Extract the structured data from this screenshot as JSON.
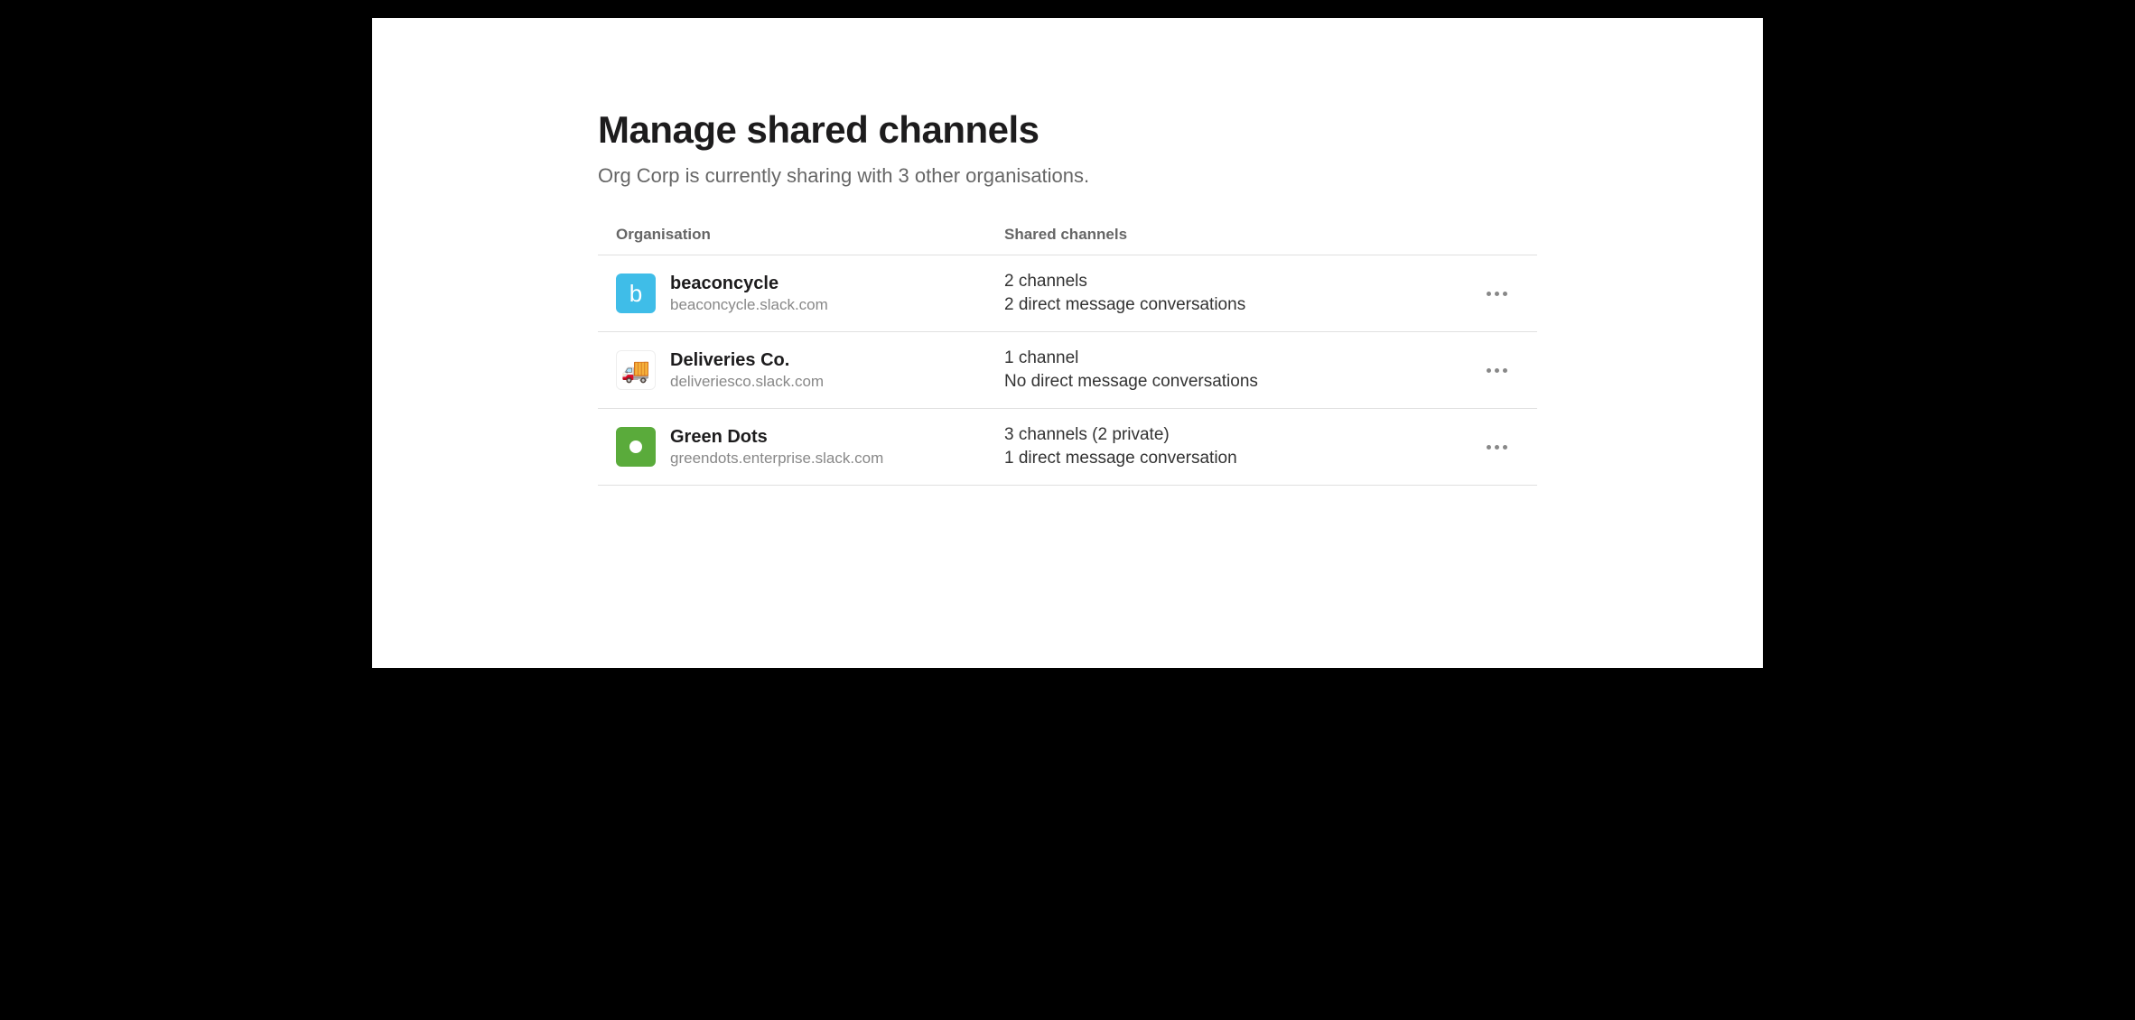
{
  "page": {
    "title": "Manage shared channels",
    "subtitle": "Org Corp is currently sharing with 3 other organisations."
  },
  "table": {
    "headers": {
      "organisation": "Organisation",
      "shared_channels": "Shared channels"
    },
    "rows": [
      {
        "avatar_type": "blue",
        "avatar_letter": "b",
        "name": "beaconcycle",
        "domain": "beaconcycle.slack.com",
        "channels": "2 channels",
        "dms": "2 direct message conversations"
      },
      {
        "avatar_type": "truck",
        "avatar_emoji": "🚚",
        "name": "Deliveries Co.",
        "domain": "deliveriesco.slack.com",
        "channels": "1 channel",
        "dms": "No direct message conversations"
      },
      {
        "avatar_type": "green",
        "name": "Green Dots",
        "domain": "greendots.enterprise.slack.com",
        "channels": "3 channels (2 private)",
        "dms": "1 direct message conversation"
      }
    ]
  }
}
